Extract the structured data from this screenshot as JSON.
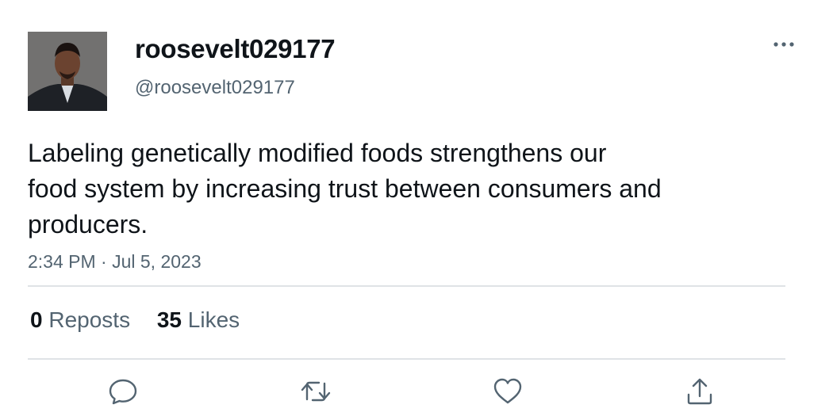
{
  "tweet": {
    "display_name": "roosevelt029177",
    "handle": "@roosevelt029177",
    "text_lines": [
      "Labeling genetically modified foods strengthens our",
      "food system by increasing trust between consumers and",
      "producers."
    ],
    "timestamp": "2:34 PM · Jul 5, 2023",
    "stats": {
      "reposts_count": "0",
      "reposts_label": "Reposts",
      "likes_count": "35",
      "likes_label": "Likes"
    }
  },
  "icons": {
    "more": "more-horizontal-icon",
    "reply": "reply-icon",
    "repost": "repost-icon",
    "like": "heart-icon",
    "share": "share-icon"
  },
  "colors": {
    "text_primary": "#0f1419",
    "text_secondary": "#536471",
    "divider": "#dfe3e6"
  }
}
